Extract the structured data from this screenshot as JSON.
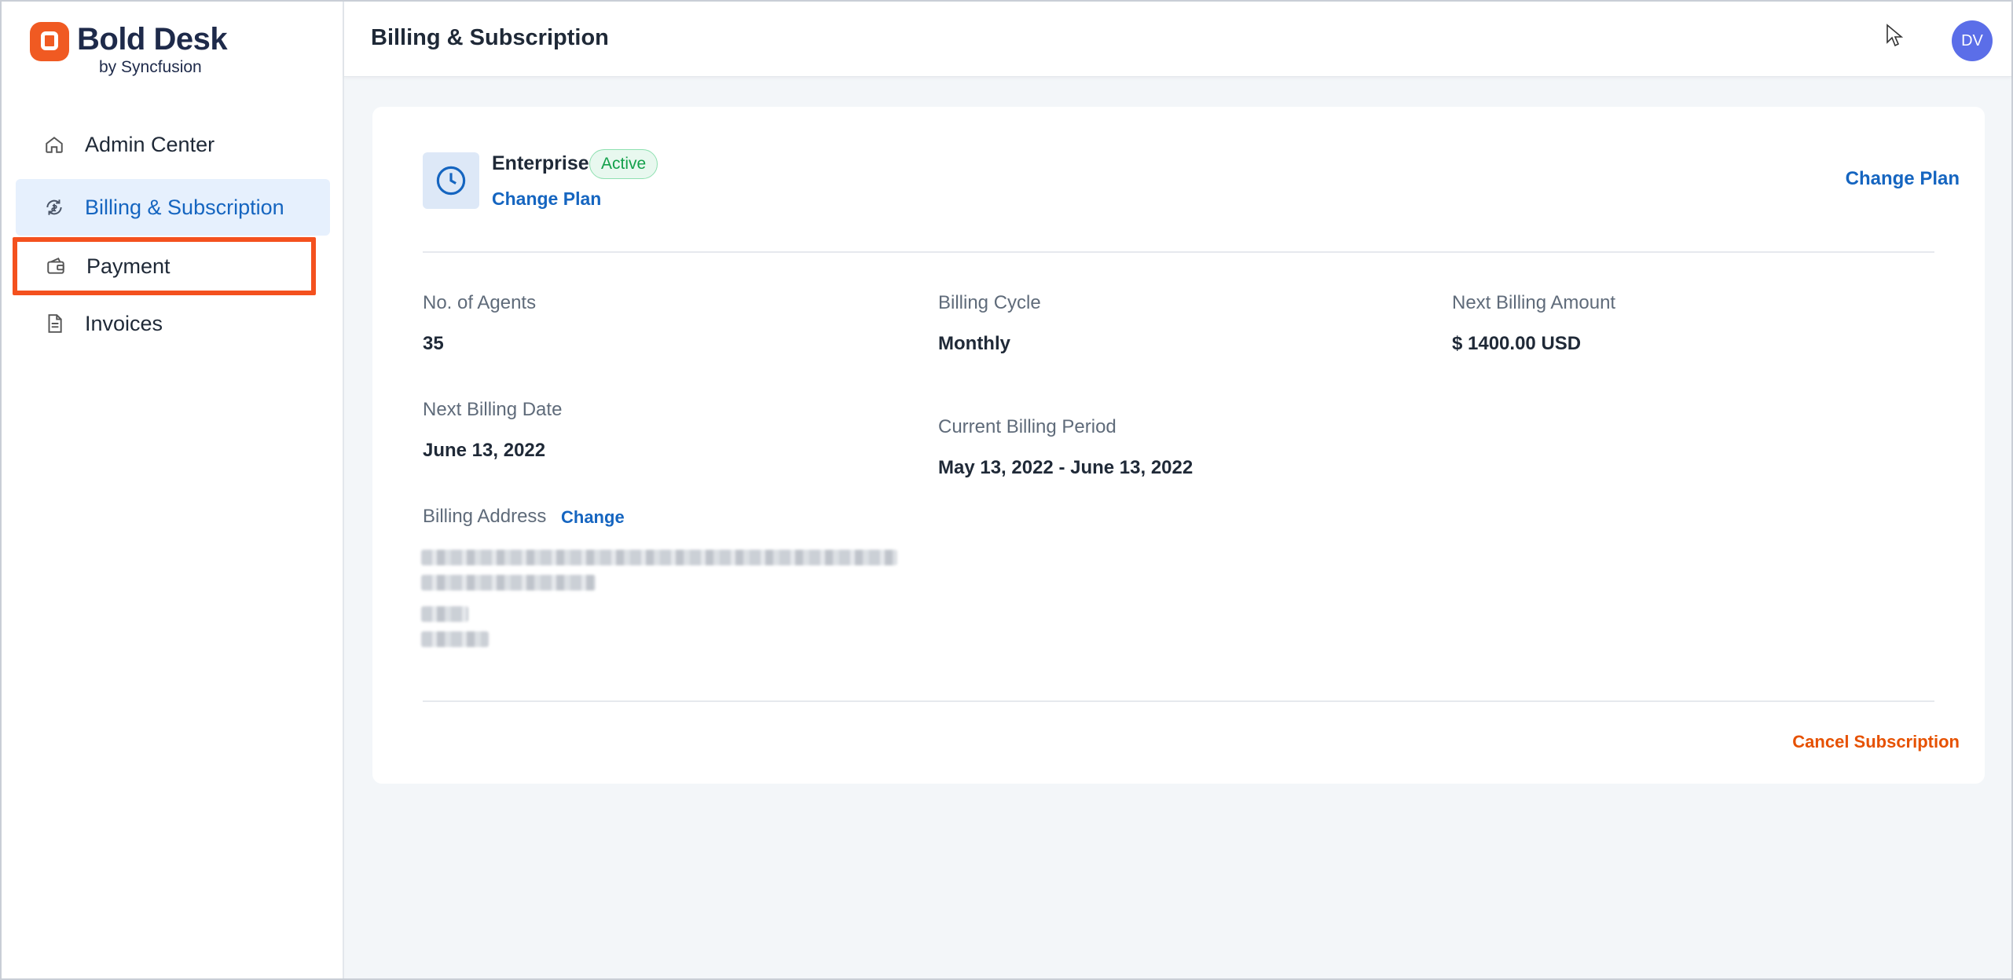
{
  "brand": {
    "name": "Bold Desk",
    "sub": "by Syncfusion",
    "accent": "#f05a22"
  },
  "sidebar": {
    "items": [
      {
        "label": "Admin Center",
        "icon": "home-icon"
      },
      {
        "label": "Billing & Subscription",
        "icon": "billing-icon",
        "active": true
      },
      {
        "label": "Payment",
        "icon": "wallet-icon",
        "highlighted": true
      },
      {
        "label": "Invoices",
        "icon": "document-icon"
      }
    ]
  },
  "header": {
    "title": "Billing & Subscription",
    "avatar_initials": "DV"
  },
  "plan": {
    "name": "Enterprise",
    "status": "Active",
    "change_label": "Change Plan",
    "change_label_right": "Change Plan"
  },
  "details": {
    "agents_label": "No. of Agents",
    "agents_value": "35",
    "cycle_label": "Billing Cycle",
    "cycle_value": "Monthly",
    "amount_label": "Next Billing Amount",
    "amount_value": "$ 1400.00 USD",
    "next_date_label": "Next Billing Date",
    "next_date_value": "June 13, 2022",
    "period_label": "Current Billing Period",
    "period_value": "May 13, 2022 - June 13, 2022",
    "address_label": "Billing Address",
    "address_change": "Change"
  },
  "actions": {
    "cancel_label": "Cancel Subscription"
  }
}
